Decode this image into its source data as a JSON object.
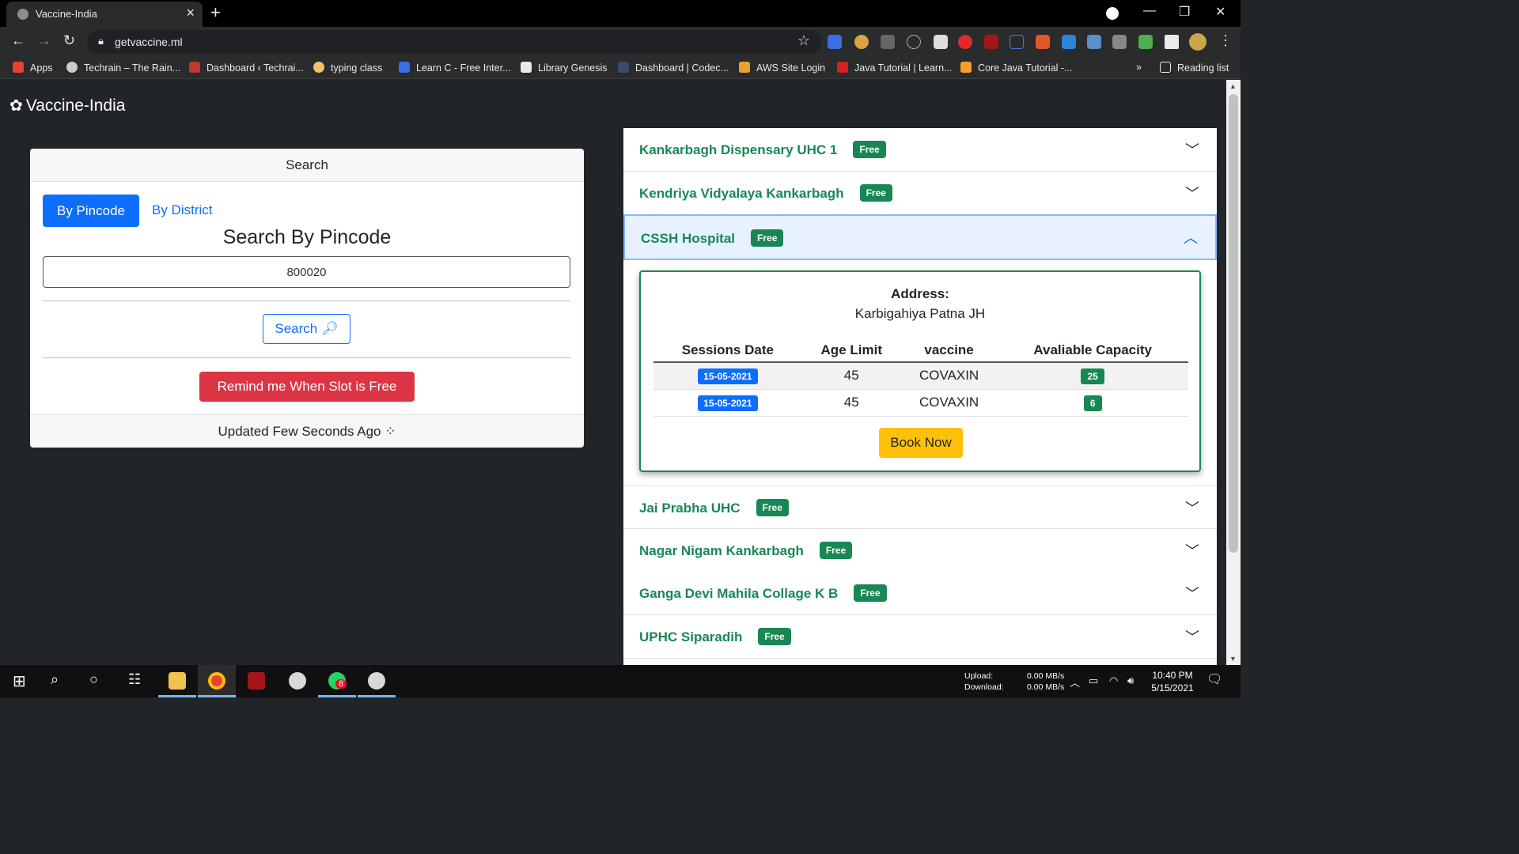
{
  "browser": {
    "tab_title": "Vaccine-India",
    "url": "getvaccine.ml",
    "bookmarks": [
      {
        "label": "Apps",
        "color": "#e94235"
      },
      {
        "label": "Techrain – The Rain...",
        "color": "#cccccc"
      },
      {
        "label": "Dashboard ‹ Techrai...",
        "color": "#c0392b"
      },
      {
        "label": "typing class",
        "color": "#f5c16c"
      },
      {
        "label": "Learn C - Free Inter...",
        "color": "#3b6ee6"
      },
      {
        "label": "Library Genesis",
        "color": "#e8eaed"
      },
      {
        "label": "Dashboard | Codec...",
        "color": "#3a4a6b"
      },
      {
        "label": "AWS Site Login",
        "color": "#e7a32d"
      },
      {
        "label": "Java Tutorial | Learn...",
        "color": "#d71f26"
      },
      {
        "label": "Core Java Tutorial -...",
        "color": "#f59e2f"
      }
    ],
    "reading_list": "Reading list",
    "overflow": "»"
  },
  "app": {
    "brand": "Vaccine-India",
    "search_card": {
      "header": "Search",
      "tab_pincode": "By Pincode",
      "tab_district": "By District",
      "heading": "Search By Pincode",
      "pincode_value": "800020",
      "search_button": "Search",
      "remind_button": "Remind me When Slot is Free",
      "footer": "Updated Few Seconds Ago"
    },
    "centers": [
      {
        "name": "Kankarbagh Dispensary UHC 1",
        "fee": "Free",
        "open": false
      },
      {
        "name": "Kendriya Vidyalaya Kankarbagh",
        "fee": "Free",
        "open": false
      },
      {
        "name": "CSSH Hospital",
        "fee": "Free",
        "open": true
      },
      {
        "name": "Jai Prabha UHC",
        "fee": "Free",
        "open": false
      },
      {
        "name": "Nagar Nigam Kankarbagh",
        "fee": "Free",
        "open": false
      },
      {
        "name": "Ganga Devi Mahila Collage K B",
        "fee": "Free",
        "open": false
      },
      {
        "name": "UPHC Siparadih",
        "fee": "Free",
        "open": false
      }
    ],
    "detail": {
      "address_label": "Address:",
      "address": "Karbigahiya Patna JH",
      "columns": [
        "Sessions Date",
        "Age Limit",
        "vaccine",
        "Avaliable Capacity"
      ],
      "rows": [
        {
          "date": "15-05-2021",
          "age": "45",
          "vaccine": "COVAXIN",
          "capacity": "25"
        },
        {
          "date": "15-05-2021",
          "age": "45",
          "vaccine": "COVAXIN",
          "capacity": "6"
        }
      ],
      "book_button": "Book Now"
    }
  },
  "taskbar": {
    "upload_label": "Upload:",
    "download_label": "Download:",
    "upload_value": "0.00 MB/s",
    "download_value": "0.00 MB/s",
    "time": "10:40 PM",
    "date": "5/15/2021",
    "whatsapp_badge": "8"
  },
  "colors": {
    "primary": "#0d6efd",
    "success": "#198754",
    "danger": "#dc3545",
    "warning": "#ffc107",
    "page_bg": "#212529"
  }
}
